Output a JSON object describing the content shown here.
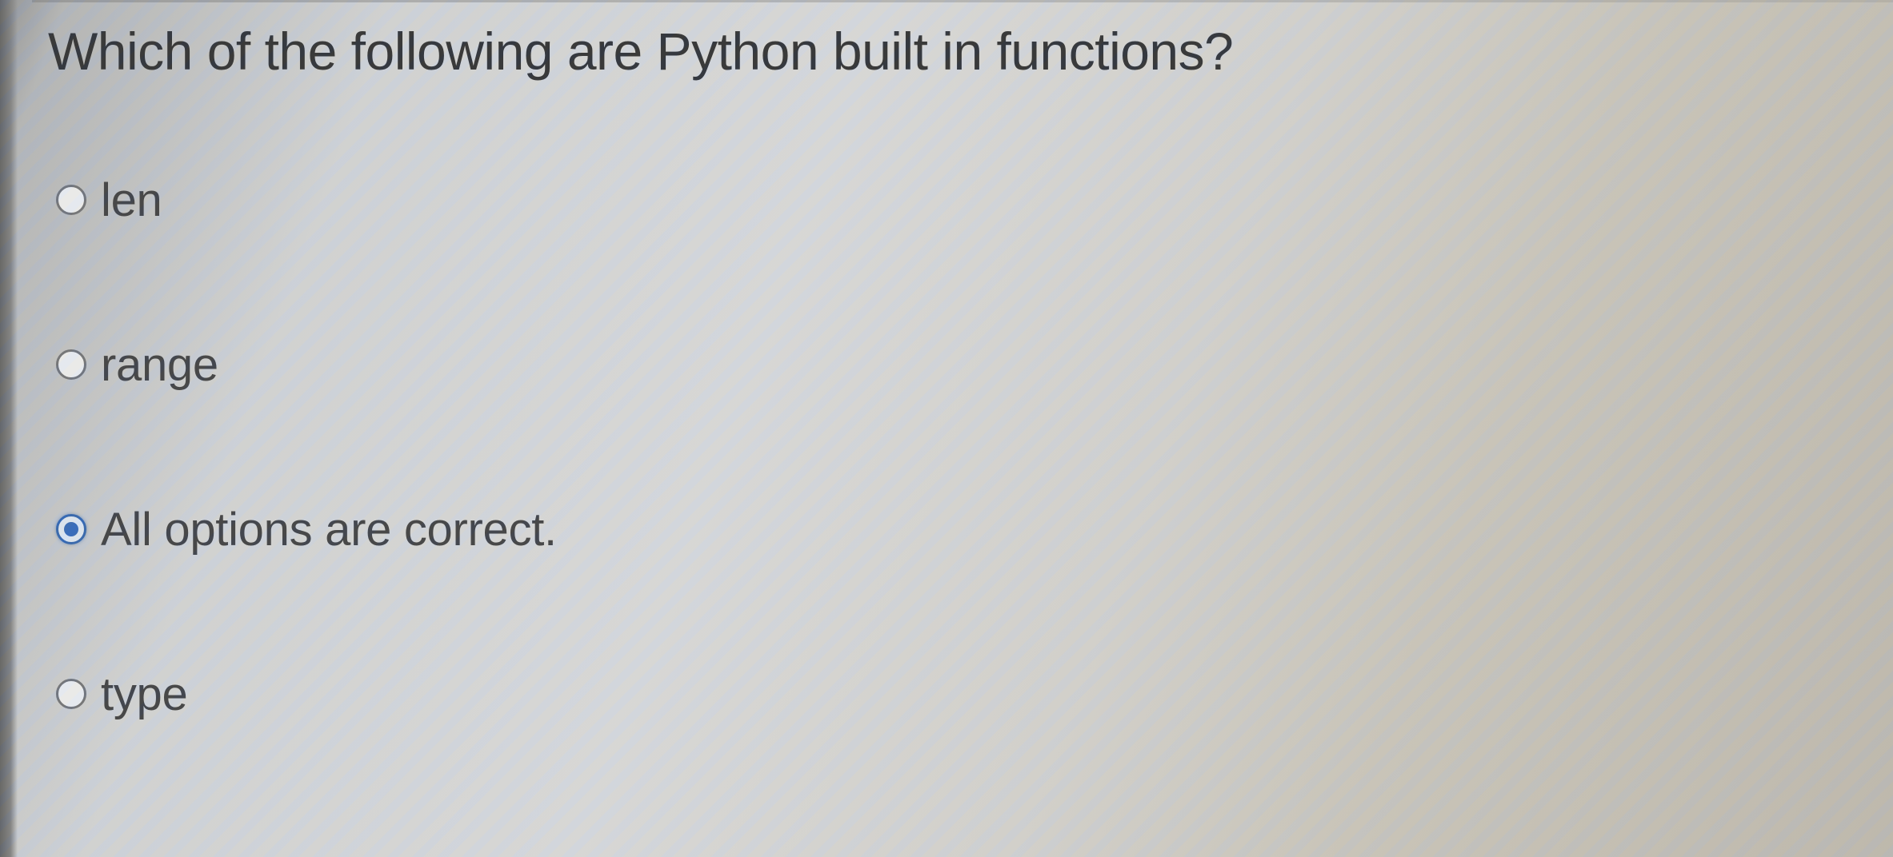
{
  "question": {
    "text": "Which of the following are Python built in functions?"
  },
  "options": [
    {
      "label": "len",
      "selected": false
    },
    {
      "label": "range",
      "selected": false
    },
    {
      "label": "All options are correct.",
      "selected": true
    },
    {
      "label": "type",
      "selected": false
    }
  ],
  "colors": {
    "radio_selected": "#2f66b8",
    "radio_border": "#6d7076",
    "text": "#2a2c30"
  }
}
